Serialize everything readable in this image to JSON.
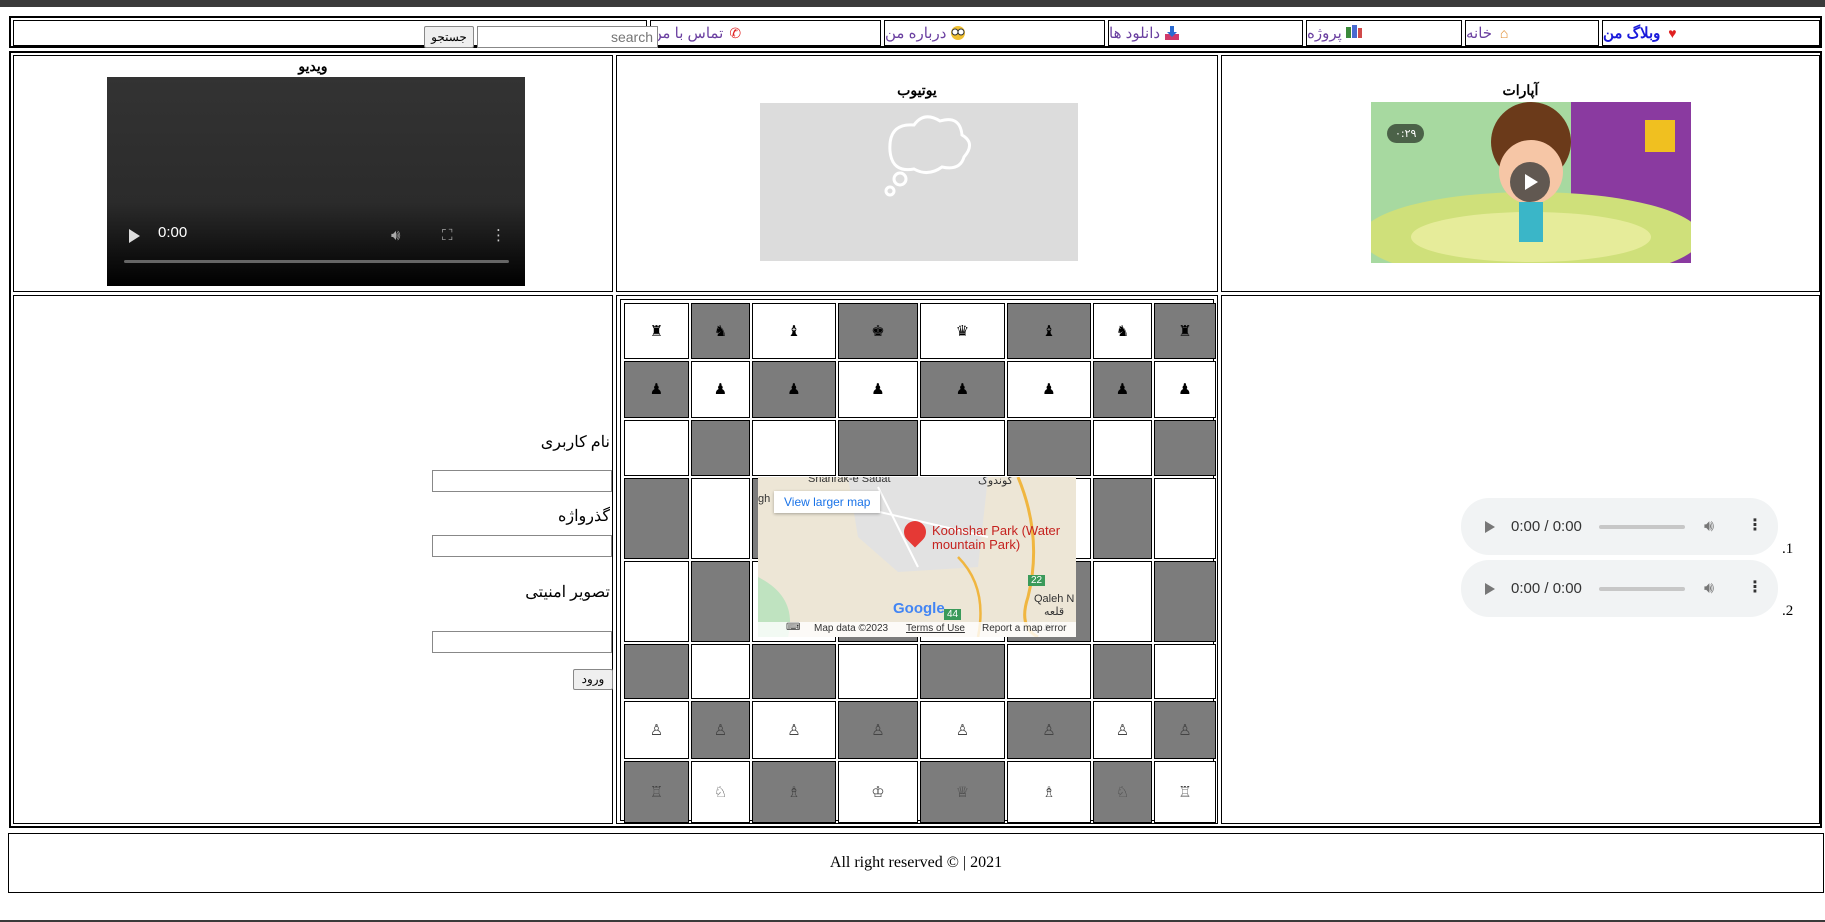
{
  "nav": {
    "brand": "وبلاگ من",
    "home": "خانه",
    "project": "پروژه",
    "downloads": "دانلود ها",
    "about": "درباره من",
    "contact": "تماس با من",
    "search_placeholder": "search",
    "search_button": "جستجو",
    "icons": {
      "brand": "heart-icon",
      "home": "house-icon",
      "project": "books-icon",
      "downloads": "download-icon",
      "about": "glasses-face-icon",
      "contact": "phone-icon"
    }
  },
  "media": {
    "aparat_title": "آپارات",
    "aparat_duration": "۰:۲۹",
    "youtube_title": "یوتیوب",
    "video_title": "ویدیو",
    "video_time": "0:00"
  },
  "chess": {
    "rows": [
      [
        "♜",
        "♞",
        "♝",
        "♚",
        "♛",
        "♝",
        "♞",
        "♜"
      ],
      [
        "♟",
        "♟",
        "♟",
        "♟",
        "♟",
        "♟",
        "♟",
        "♟"
      ],
      [
        "",
        "",
        "",
        "",
        "",
        "",
        "",
        ""
      ],
      [
        "",
        "",
        "",
        "",
        "",
        "",
        "",
        ""
      ],
      [
        "",
        "",
        "",
        "",
        "",
        "",
        "",
        ""
      ],
      [
        "",
        "",
        "",
        "",
        "",
        "",
        "",
        ""
      ],
      [
        "♙",
        "♙",
        "♙",
        "♙",
        "♙",
        "♙",
        "♙",
        "♙"
      ],
      [
        "♖",
        "♘",
        "♗",
        "♔",
        "♕",
        "♗",
        "♘",
        "♖"
      ]
    ]
  },
  "map": {
    "link": "View larger map",
    "place": "Koohshar Park (Water mountain Park)",
    "label_top_left": "Shahrak-e Sadat",
    "label_top_right": "کوندوک",
    "label_left": "gh",
    "label_bottom_right": "Qaleh N",
    "label_bottom_right2": "قلعه نو",
    "road_22": "22",
    "road_44": "44",
    "logo": "Google",
    "attribution": "Map data ©2023",
    "terms": "Terms of Use",
    "report": "Report a map error"
  },
  "login": {
    "username_label": "نام کاربری",
    "password_label": "گذرواژه",
    "captcha_label": "تصویر امنیتی",
    "submit": "ورود"
  },
  "audio": [
    {
      "num": ".1",
      "time": "0:00 / 0:00"
    },
    {
      "num": ".2",
      "time": "0:00 / 0:00"
    }
  ],
  "footer": {
    "text": "All right reserved © | 2021"
  },
  "colors": {
    "dark_square": "#7c7c7c",
    "light_square": "#ffffff",
    "nav_link": "#6a3fa0",
    "brand": "#1a1adb"
  }
}
